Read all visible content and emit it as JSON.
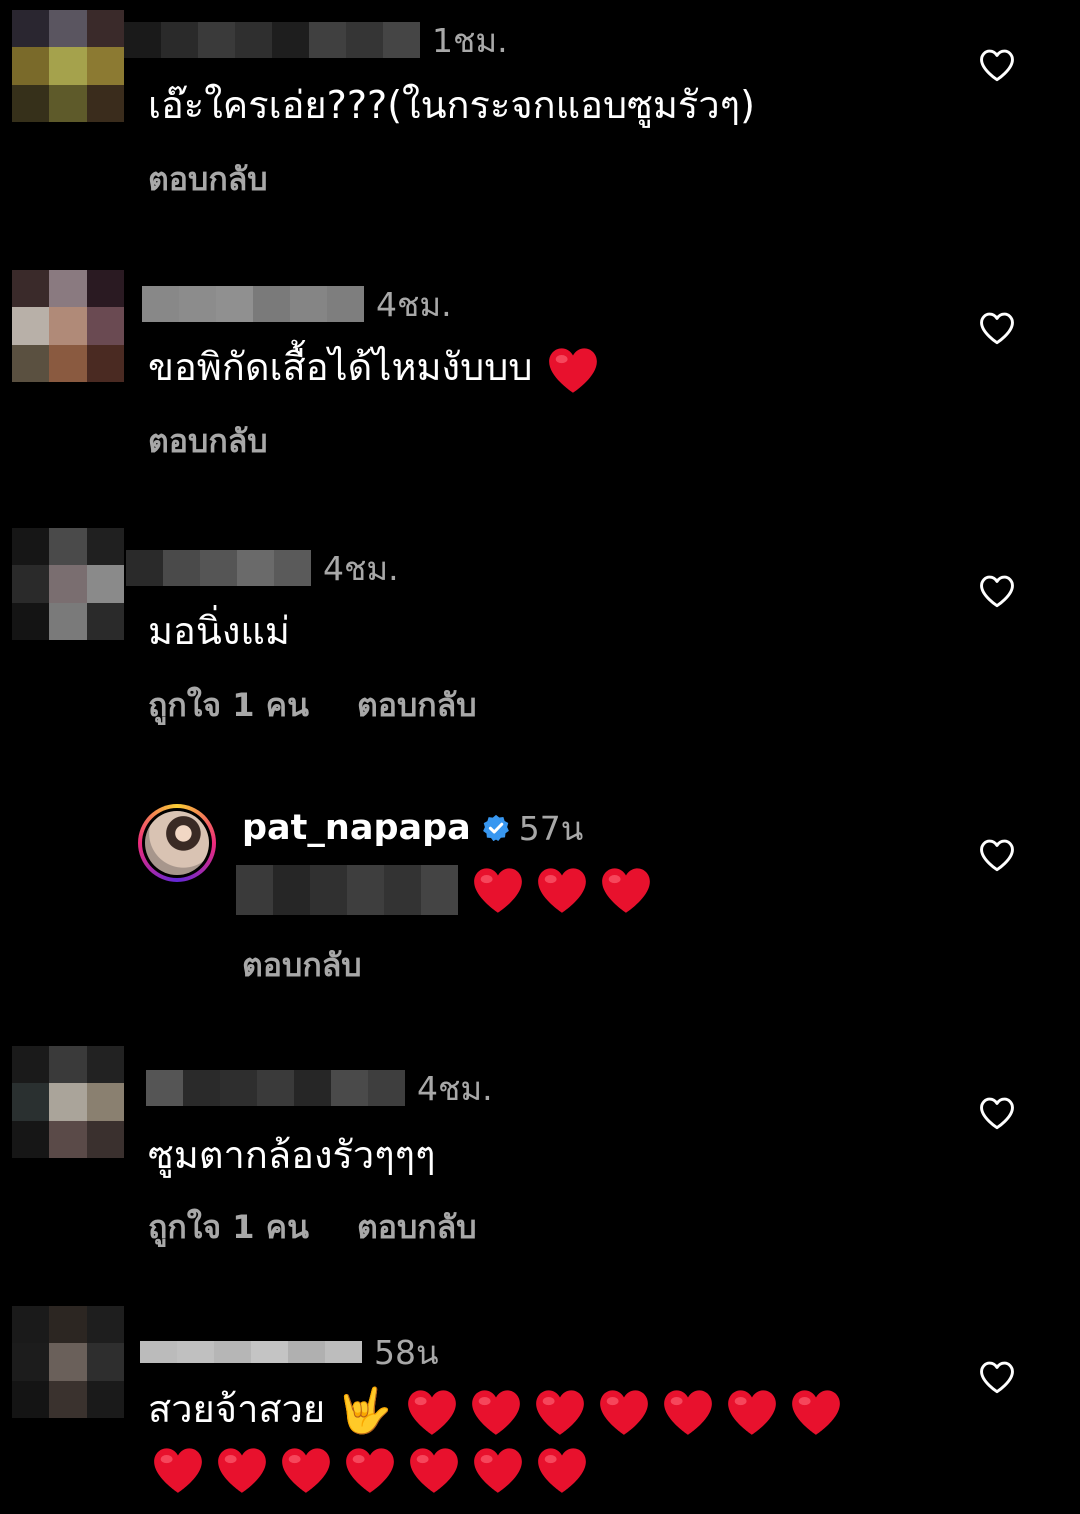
{
  "comments": [
    {
      "avatar_colors": [
        "#2a2630",
        "#5a5560",
        "#3a2a2a",
        "#7a6a2a",
        "#a5a24c",
        "#8c7a32",
        "#36301a",
        "#5e5a2a",
        "#3a2c1c"
      ],
      "username_blur": [
        "#1a1a1a",
        "#2a2a2a",
        "#3a3a3a",
        "#2f2f2f",
        "#1e1e1e",
        "#404040",
        "#353535",
        "#454545"
      ],
      "time": "1ชม.",
      "text": "เอ๊ะใครเอ่ย???(ในกระจกแอบซูมรัวๆ)",
      "like_count": "",
      "reply_label": "ตอบกลับ"
    },
    {
      "avatar_colors": [
        "#3a2a2a",
        "#8a7a80",
        "#2a1a22",
        "#b8b0a8",
        "#b08a78",
        "#6a4a52",
        "#5a5040",
        "#8a5a40",
        "#4a2a22"
      ],
      "username_blur": [
        "#888888",
        "#8c8c8c",
        "#909090",
        "#7a7a7a",
        "#858585",
        "#7e7e7e"
      ],
      "time": "4ชม.",
      "text": "ขอพิกัดเสื้อได้ไหมงับบบ",
      "like_count": "",
      "reply_label": "ตอบกลับ"
    },
    {
      "avatar_colors": [
        "#161616",
        "#4a4a4a",
        "#202020",
        "#2a2a2a",
        "#7a6e70",
        "#8a8a8a",
        "#141414",
        "#7a7a7a",
        "#2a2a2a"
      ],
      "username_blur": [
        "#2a2a2a",
        "#4a4a4a",
        "#555555",
        "#6a6a6a",
        "#5a5a5a"
      ],
      "time": "4ชม.",
      "text": "มอนิ่งแม่",
      "like_count": "ถูกใจ 1 คน",
      "reply_label": "ตอบกลับ"
    },
    {
      "avatar_colors": [
        "#1a1a1a",
        "#3a3a3a",
        "#222222",
        "#2a3030",
        "#aaa49a",
        "#8a8070",
        "#161616",
        "#5a4a48",
        "#3a302e"
      ],
      "username_blur": [
        "#555555",
        "#2a2a2a",
        "#2e2e2e",
        "#3a3a3a",
        "#262626",
        "#4a4a4a",
        "#3e3e3e"
      ],
      "time": "4ชม.",
      "text": "ซูมตากล้องรัวๆๆๆ",
      "like_count": "ถูกใจ 1 คน",
      "reply_label": "ตอบกลับ"
    },
    {
      "avatar_colors": [
        "#1a1a1a",
        "#2c2622",
        "#1e1e1e",
        "#1c1c1c",
        "#6a605a",
        "#2e2e2e",
        "#141414",
        "#3a322e",
        "#1a1a1a"
      ],
      "username_blur": [
        "#bbbbbb",
        "#c0c0c0",
        "#b6b6b6",
        "#c4c4c4",
        "#b0b0b0",
        "#bdbdbd"
      ],
      "time": "58น",
      "text": "สวยจ้าสวย",
      "like_count": "",
      "reply_label": ""
    }
  ],
  "reply": {
    "username": "pat_napapa",
    "time": "57น",
    "reply_label": "ตอบกลับ",
    "text_blur": [
      "#3a3a3a",
      "#262626",
      "#303030",
      "#3e3e3e",
      "#333333",
      "#444444"
    ]
  },
  "icons": {
    "heart_outline": "heart-outline-icon",
    "heart_emoji": "red-heart-emoji",
    "verified": "verified-badge-icon",
    "rock_hand": "🤟"
  },
  "colors": {
    "background": "#000000",
    "text": "#ffffff",
    "secondary": "#a8a8a8",
    "heart": "#e8112d",
    "verified": "#3897f0"
  }
}
